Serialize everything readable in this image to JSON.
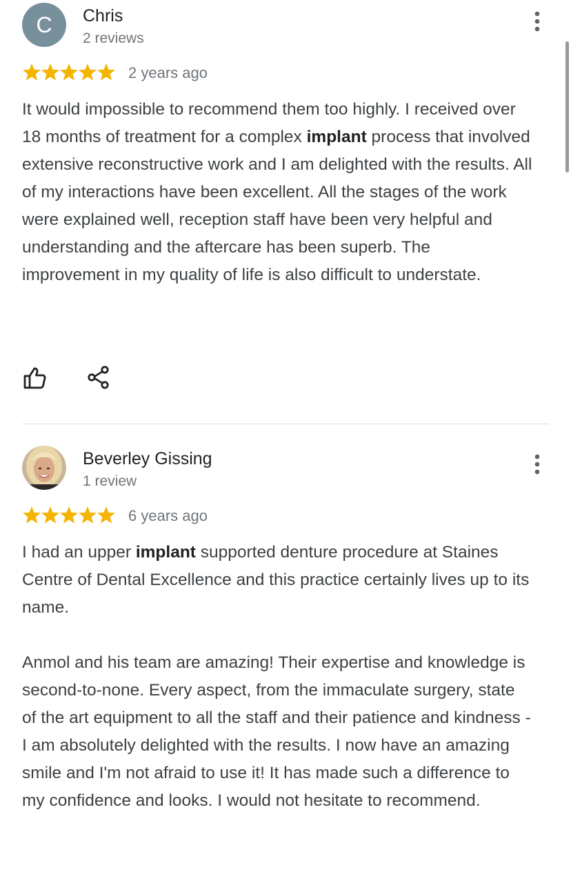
{
  "reviews": [
    {
      "avatar_letter": "C",
      "name": "Chris",
      "meta": "2 reviews",
      "rating": 5,
      "date": "2 years ago",
      "text": {
        "t1": "It would impossible to recommend them too highly. I received over 18 months of treatment for a complex ",
        "highlight": "implant",
        "t2": " process that involved extensive reconstructive work and I am delighted with the results. All of my interactions have been excellent. All the stages of the work were explained well, reception staff have been very helpful and understanding and the aftercare has been superb. The improvement in my quality of life is also difficult to understate."
      }
    },
    {
      "name": "Beverley Gissing",
      "meta": "1 review",
      "rating": 5,
      "date": "6 years ago",
      "text": {
        "t1": "I had an upper ",
        "highlight": "implant",
        "t2": " supported denture procedure at Staines Centre of Dental Excellence and this practice certainly lives up to its name.",
        "p2": "Anmol and his team are amazing!  Their expertise and knowledge is second-to-none.  Every aspect, from the immaculate surgery, state of the art equipment to all the staff and their patience and kindness - I am absolutely delighted with the results.  I now have an amazing smile and I'm not afraid to use it!  It has made such a difference to my confidence and looks.  I would not hesitate to recommend."
      }
    }
  ],
  "icons": {
    "more": "more-vert-icon",
    "star": "star-icon",
    "like": "thumb-up-icon",
    "share": "share-icon"
  },
  "colors": {
    "star": "#f4b400",
    "avatar_bg": "#78909c",
    "secondary_text": "#70757a",
    "body_text": "#3c4043",
    "divider": "#dadce0"
  }
}
